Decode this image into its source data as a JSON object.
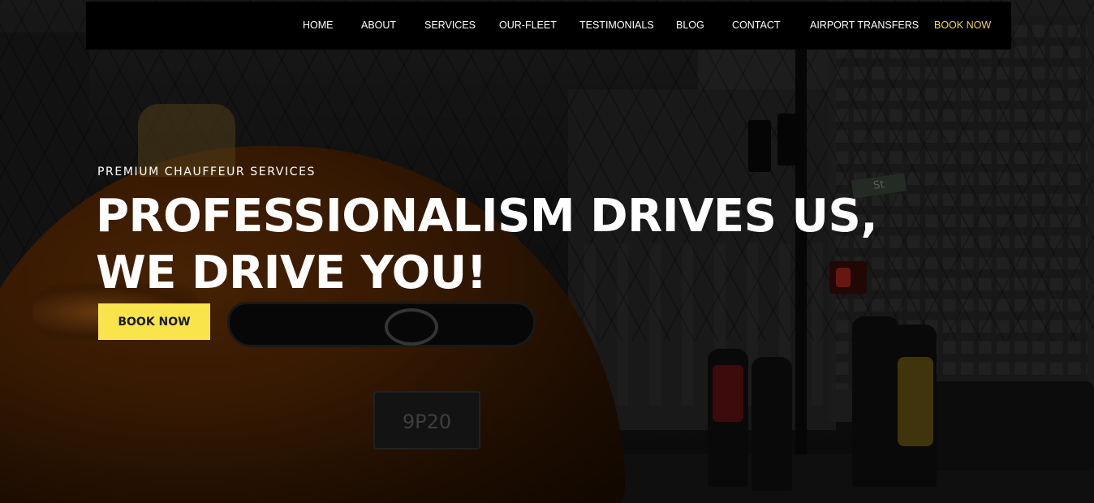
{
  "nav": {
    "items": [
      {
        "label": "HOME"
      },
      {
        "label": "ABOUT"
      },
      {
        "label": "SERVICES"
      },
      {
        "label": "OUR-FLEET"
      },
      {
        "label": "TESTIMONIALS"
      },
      {
        "label": "BLOG"
      },
      {
        "label": "CONTACT"
      },
      {
        "label": "AIRPORT TRANSFERS"
      },
      {
        "label": "BOOK NOW"
      }
    ],
    "accent_color": "#f4d94b"
  },
  "hero": {
    "eyebrow": "PREMIUM CHAUFFEUR SERVICES",
    "title": "PROFESSIONALISM DRIVES US, WE DRIVE YOU!",
    "cta_label": "BOOK NOW",
    "cta_color": "#f9e44b"
  },
  "background": {
    "street_sign_text": "St",
    "plate_text": "9P20"
  }
}
